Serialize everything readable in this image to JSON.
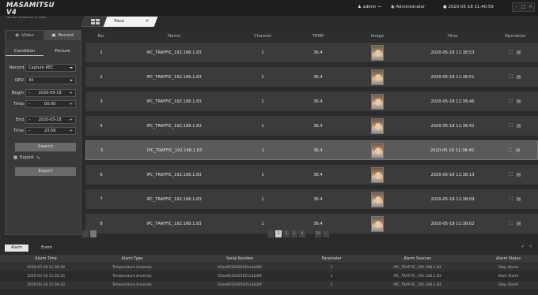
{
  "brand": {
    "name": "MASAMITSU V4",
    "tagline": "SECURITY TECHNOLOGY OF JAPAN"
  },
  "tabs": {
    "face_label": "Face"
  },
  "user": {
    "name": "admin",
    "role": "Administrator",
    "datetime": "2020-05-18 11:40:59"
  },
  "left_panel": {
    "tab_video": "Video",
    "tab_record": "Record",
    "sub_condition": "Condition",
    "sub_picture": "Picture",
    "record_label": "Record",
    "record_value": "Capture REC",
    "dev_label": "DEV",
    "dev_value": "All",
    "begin_label": "Begin",
    "begin_date": "2020-05-18",
    "begin_time_label": "Time",
    "begin_time": "00:00",
    "end_label": "End",
    "end_date": "2020-05-18",
    "end_time_label": "Time",
    "end_time": "23:59",
    "search_label": "Search",
    "export_label": "Export",
    "export_button": "Export"
  },
  "table": {
    "headers": [
      "No.",
      "Name",
      "Channel",
      "TEMP",
      "Image",
      "Time",
      "Operation"
    ],
    "selected_row": 5,
    "rows": [
      {
        "no": "1",
        "name": "IPC_TRAFFIC_192.168.1.83",
        "channel": "1",
        "temp": "36.4",
        "time": "2020-05-18 11:38:53"
      },
      {
        "no": "2",
        "name": "IPC_TRAFFIC_192.168.1.83",
        "channel": "1",
        "temp": "36.4",
        "time": "2020-05-18 11:38:51"
      },
      {
        "no": "3",
        "name": "IPC_TRAFFIC_192.168.1.83",
        "channel": "1",
        "temp": "36.4",
        "time": "2020-05-18 11:38:46"
      },
      {
        "no": "4",
        "name": "IPC_TRAFFIC_192.168.1.83",
        "channel": "1",
        "temp": "36.4",
        "time": "2020-05-18 11:38:42"
      },
      {
        "no": "5",
        "name": "IPC_TRAFFIC_192.168.1.83",
        "channel": "1",
        "temp": "36.4",
        "time": "2020-05-18 11:38:40"
      },
      {
        "no": "6",
        "name": "IPC_TRAFFIC_192.168.1.83",
        "channel": "1",
        "temp": "36.4",
        "time": "2020-05-18 11:38:13"
      },
      {
        "no": "7",
        "name": "IPC_TRAFFIC_192.168.1.83",
        "channel": "1",
        "temp": "36.4",
        "time": "2020-05-18 11:38:09"
      },
      {
        "no": "8",
        "name": "IPC_TRAFFIC_192.168.1.83",
        "channel": "1",
        "temp": "36.4",
        "time": "2020-05-18 11:38:02"
      }
    ]
  },
  "pagination": {
    "pages": [
      "1",
      "2",
      "3",
      "4",
      "...",
      "10"
    ],
    "current": "1"
  },
  "alarm_panel": {
    "tab_alarm": "Alarm",
    "tab_event": "Event",
    "headers": [
      "Alarm Time",
      "Alarm Type",
      "Serial Number",
      "Parameter",
      "Alarm Sources",
      "Alarm Status"
    ],
    "rows": [
      {
        "time": "2020-05-18 11:36:39",
        "type": "Temperature Anomaly",
        "serial": "02ae0032005621a2b36f",
        "param": "1",
        "source": "IPC_TRAFFIC_192.168.1.83",
        "status": "Stop Alarm"
      },
      {
        "time": "2020-05-18 11:36:33",
        "type": "Temperature Anomaly",
        "serial": "02ae0032005621a2b36f",
        "param": "1",
        "source": "IPC_TRAFFIC_192.168.1.83",
        "status": "Start Alarm"
      },
      {
        "time": "2020-05-18 11:36:33",
        "type": "Temperature Anomaly",
        "serial": "02ae0032005621a2b36f",
        "param": "1",
        "source": "IPC_TRAFFIC_192.168.1.83",
        "status": "Stop Alarm"
      }
    ]
  },
  "colors": {
    "accent_selected_row": "#5a5a5a",
    "background": "#2b2b2b",
    "row": "#3b3b3b"
  },
  "icons": {
    "user": "user-icon",
    "admin": "shield-icon",
    "clock": "clock-icon",
    "operation_expand": "expand-icon",
    "operation_save": "save-icon"
  }
}
